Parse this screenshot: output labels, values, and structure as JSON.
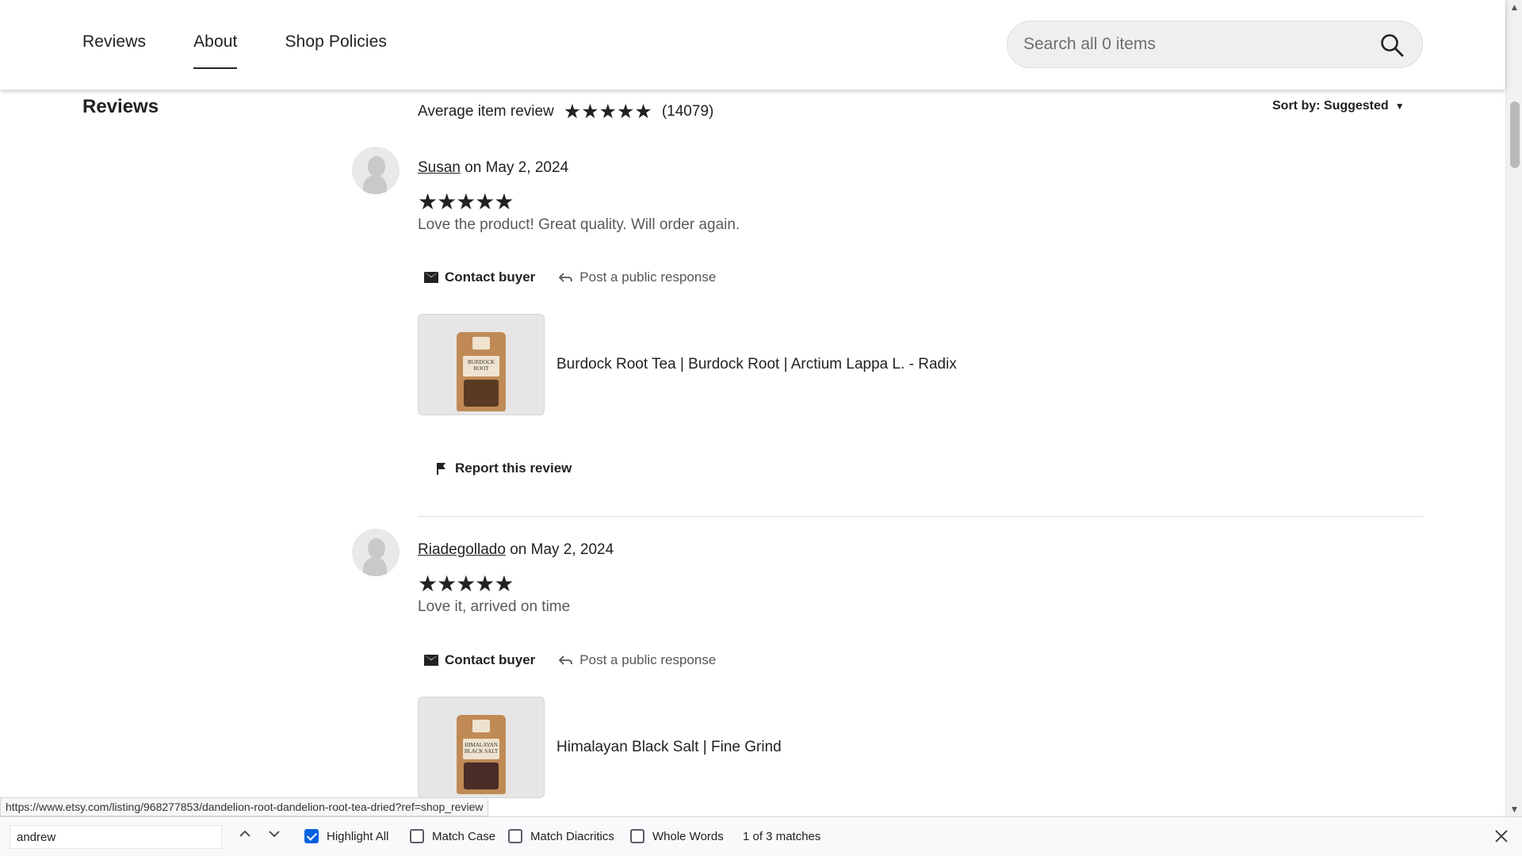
{
  "nav": {
    "tabs": [
      {
        "label": "Reviews"
      },
      {
        "label": "About"
      },
      {
        "label": "Shop Policies"
      }
    ],
    "active_tab": "About",
    "search_placeholder": "Search all 0 items"
  },
  "reviews_section": {
    "title": "Reviews",
    "average_label": "Average item review",
    "average_stars": "★★★★★",
    "review_count": "(14079)",
    "sort_label": "Sort by: Suggested",
    "sort_caret": "▼"
  },
  "reviews": [
    {
      "user": "Susan",
      "date": "on May 2, 2024",
      "stars": "★★★★★",
      "text": "Love the product! Great quality. Will order again.",
      "contact_label": "Contact buyer",
      "post_label": "Post a public response",
      "product_title": "Burdock Root Tea | Burdock Root | Arctium Lappa L. - Radix",
      "product_label": "BURDOCK ROOT",
      "report_label": "Report this review"
    },
    {
      "user": "Riadegollado",
      "date": "on May 2, 2024",
      "stars": "★★★★★",
      "text": "Love it, arrived on time",
      "contact_label": "Contact buyer",
      "post_label": "Post a public response",
      "product_title": "Himalayan Black Salt | Fine Grind",
      "product_label": "HIMALAYAN BLACK SALT"
    }
  ],
  "status_url": "https://www.etsy.com/listing/968277853/dandelion-root-dandelion-root-tea-dried?ref=shop_review",
  "find_bar": {
    "query": "andrew",
    "highlight_all": "Highlight All",
    "highlight_all_checked": true,
    "match_case": "Match Case",
    "match_diacritics": "Match Diacritics",
    "whole_words": "Whole Words",
    "matches": "1 of 3 matches"
  }
}
